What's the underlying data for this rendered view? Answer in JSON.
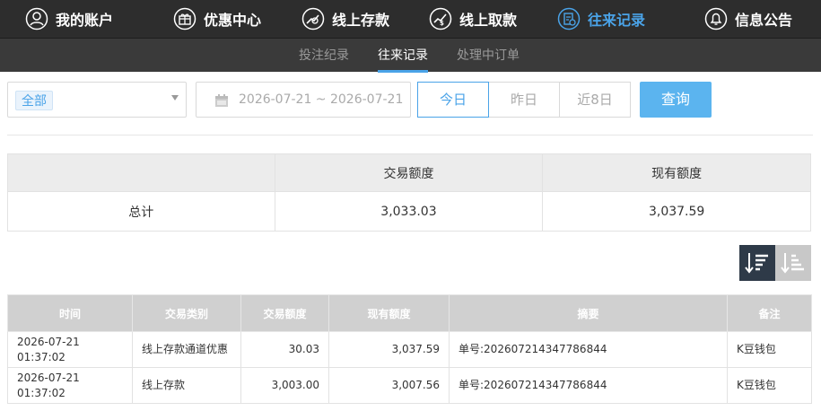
{
  "topnav": {
    "items": [
      {
        "label": "我的账户",
        "icon": "user-icon"
      },
      {
        "label": "优惠中心",
        "icon": "gift-icon"
      },
      {
        "label": "线上存款",
        "icon": "deposit-icon"
      },
      {
        "label": "线上取款",
        "icon": "withdraw-icon"
      },
      {
        "label": "往来记录",
        "icon": "record-icon",
        "active": true
      },
      {
        "label": "信息公告",
        "icon": "bell-icon"
      }
    ]
  },
  "subnav": {
    "tabs": [
      {
        "label": "投注纪录"
      },
      {
        "label": "往来记录",
        "active": true
      },
      {
        "label": "处理中订单"
      }
    ]
  },
  "filters": {
    "type_value": "全部",
    "date_range": "2026-07-21 ~ 2026-07-21",
    "quick": [
      "今日",
      "昨日",
      "近8日"
    ],
    "quick_selected": "今日",
    "query_label": "查询"
  },
  "summary": {
    "headers": [
      "",
      "交易额度",
      "现有额度"
    ],
    "row": {
      "label": "总计",
      "amount": "3,033.03",
      "balance": "3,037.59"
    }
  },
  "detail": {
    "headers": [
      "时间",
      "交易类别",
      "交易额度",
      "现有额度",
      "摘要",
      "备注"
    ],
    "rows": [
      {
        "time": "2026-07-21 01:37:02",
        "type": "线上存款通道优惠",
        "amount": "30.03",
        "balance": "3,037.59",
        "summary": "单号:202607214347786844",
        "remark": "K豆钱包"
      },
      {
        "time": "2026-07-21 01:37:02",
        "type": "线上存款",
        "amount": "3,003.00",
        "balance": "3,007.56",
        "summary": "单号:202607214347786844",
        "remark": "K豆钱包"
      }
    ]
  },
  "colors": {
    "accent": "#4aa3e8",
    "nav_bg": "#2d2d2d",
    "subnav_bg": "#3a3a3a",
    "query_button": "#5bb4ef"
  }
}
